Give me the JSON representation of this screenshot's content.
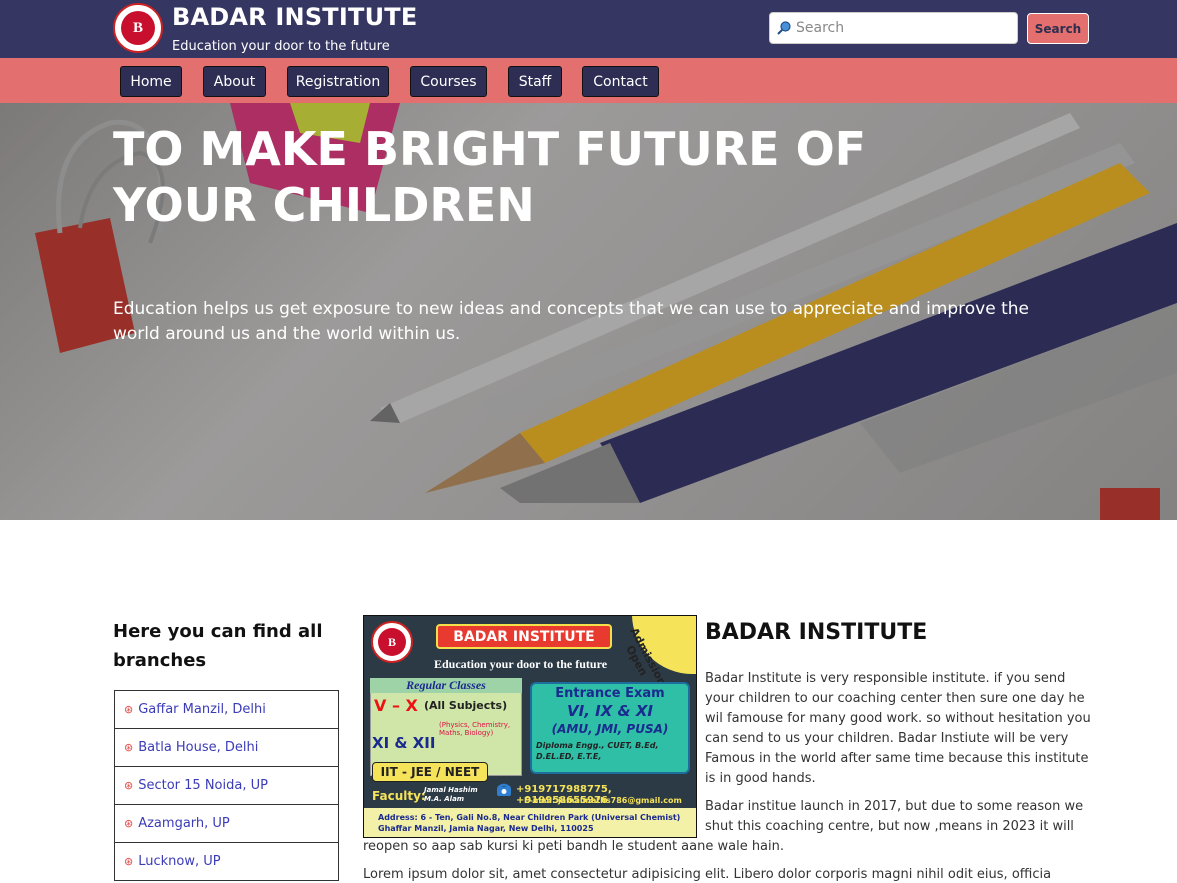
{
  "header": {
    "brand": "BADAR INSTITUTE",
    "tagline": "Education your door to the future",
    "logo_text": "B",
    "search_placeholder": "Search",
    "search_button": "Search"
  },
  "nav": {
    "items": [
      {
        "label": "Home"
      },
      {
        "label": "About"
      },
      {
        "label": "Registration"
      },
      {
        "label": "Courses"
      },
      {
        "label": "Staff"
      },
      {
        "label": "Contact"
      }
    ]
  },
  "hero": {
    "title": "TO MAKE BRIGHT FUTURE OF YOUR CHILDREN",
    "text": "Education helps us get exposure to new ideas and concepts that we can use to appreciate and improve the world around us and the world within us."
  },
  "branches": {
    "title": "Here you can find all branches",
    "items": [
      {
        "label": "Gaffar Manzil, Delhi"
      },
      {
        "label": "Batla House, Delhi"
      },
      {
        "label": "Sector 15 Noida, UP"
      },
      {
        "label": "Azamgarh, UP"
      },
      {
        "label": "Lucknow, UP"
      }
    ]
  },
  "poster": {
    "logo_text": "B",
    "name": "BADAR INSTITUTE",
    "tagline": "Education your door to the future",
    "admission": "Admission Open",
    "regular_head": "Regular Classes",
    "vx": "V – X",
    "all_subjects": "(All Subjects)",
    "xi_xii": "XI & XII",
    "subjects": "(Physics, Chemistry, Maths, Biology)",
    "entrance_head": "Entrance Exam",
    "entrance_classes": "VI, IX & XI",
    "entrance_unis": "(AMU, JMI, PUSA)",
    "entrance_more": "Diploma Engg., CUET, B.Ed, D.EL.ED, E.T.E,",
    "iit": "IIT - JEE / NEET",
    "faculty": "Faculty:",
    "faculty_names": "Jamal Hashim\nM.A. Alam",
    "phone": "+919717988775, +919958655976",
    "email": "E-mail: jamalmaths786@gmail.com",
    "address": "Address: 6 - Ten, Gali No.8, Near Children Park (Universal Chemist) Ghaffar Manzil, Jamia Nagar, New Delhi, 110025"
  },
  "about": {
    "title": "BADAR INSTITUTE",
    "p1": "Badar Institute is very responsible institute. if you send your children to our coaching center then sure one day he wil famouse for many good work. so without hesitation you can send to us your children. Badar Instiute will be very Famous in the world after same time because this institute is in good hands.",
    "p2a": "Badar institue launch in 2017, but due to some reason we shut this coaching centre, but now ,means in 2023 it will",
    "p2b": "reopen so aap sab kursi ki peti bandh le student aane wale hain.",
    "p3": "Lorem ipsum dolor sit, amet consectetur adipisicing elit. Libero dolor corporis magni nihil odit eius, officia"
  },
  "colors": {
    "header_bg": "#363662",
    "nav_bg": "#e3706f",
    "nav_button": "#2e2e55",
    "link": "#3b3bb8"
  }
}
